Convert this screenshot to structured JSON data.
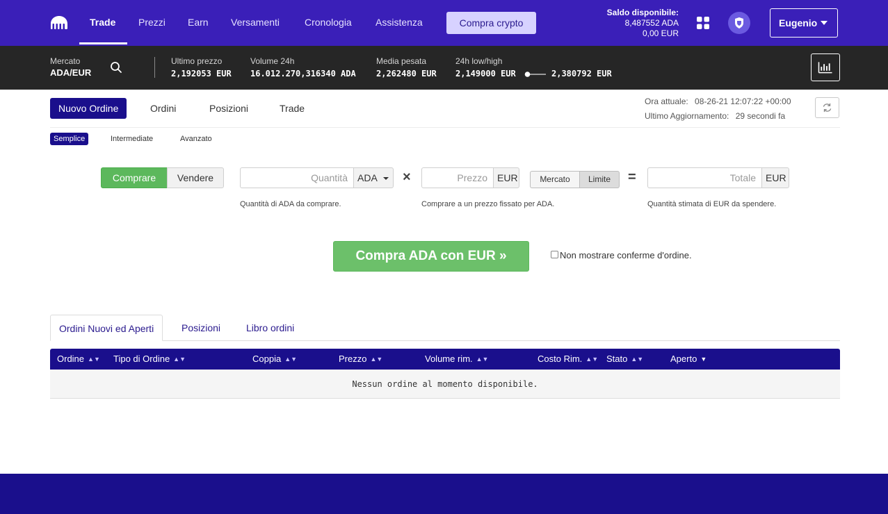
{
  "nav": {
    "items": [
      "Trade",
      "Prezzi",
      "Earn",
      "Versamenti",
      "Cronologia",
      "Assistenza"
    ],
    "buy_crypto": "Compra crypto",
    "balance_title": "Saldo disponibile:",
    "balance_ada": "8,487552 ADA",
    "balance_eur": "0,00 EUR",
    "user": "Eugenio"
  },
  "ticker": {
    "market_label": "Mercato",
    "market": "ADA/EUR",
    "last_price_label": "Ultimo prezzo",
    "last_price": "2,192053 EUR",
    "volume_label": "Volume 24h",
    "volume": "16.012.270,316340 ADA",
    "vwap_label": "Media pesata",
    "vwap": "2,262480 EUR",
    "lowhigh_label": "24h low/high",
    "low": "2,149000 EUR",
    "high": "2,380792 EUR"
  },
  "order_tabs": [
    "Nuovo Ordine",
    "Ordini",
    "Posizioni",
    "Trade"
  ],
  "time": {
    "current_label": "Ora attuale:",
    "current": "08-26-21 12:07:22 +00:00",
    "updated_label": "Ultimo Aggiornamento:",
    "updated": "29 secondi fa"
  },
  "sub_tabs": [
    "Semplice",
    "Intermediate",
    "Avanzato"
  ],
  "form": {
    "buy": "Comprare",
    "sell": "Vendere",
    "quantity_placeholder": "Quantità",
    "quantity_currency": "ADA",
    "price_placeholder": "Prezzo",
    "price_currency": "EUR",
    "market_btn": "Mercato",
    "limit_btn": "Limite",
    "total_placeholder": "Totale",
    "total_currency": "EUR",
    "times": "×",
    "equals": "=",
    "help_quantity": "Quantità di ADA da comprare.",
    "help_price": "Comprare a un prezzo fissato per ADA.",
    "help_total": "Quantità stimata di EUR da spendere.",
    "submit": "Compra ADA con EUR »",
    "confirm_label": "Non mostrare conferme d'ordine."
  },
  "bottom_tabs": [
    "Ordini Nuovi ed Aperti",
    "Posizioni",
    "Libro ordini"
  ],
  "table": {
    "headers": [
      "Ordine",
      "Tipo di Ordine",
      "Coppia",
      "Prezzo",
      "Volume rim.",
      "Costo Rim.",
      "Stato",
      "Aperto"
    ],
    "empty": "Nessun ordine al momento disponibile."
  },
  "colors": {
    "brand": "#3a1fb8",
    "dark_brand": "#1a0f8c",
    "buy_green": "#5cb85c",
    "ticker_bg": "#262626"
  }
}
